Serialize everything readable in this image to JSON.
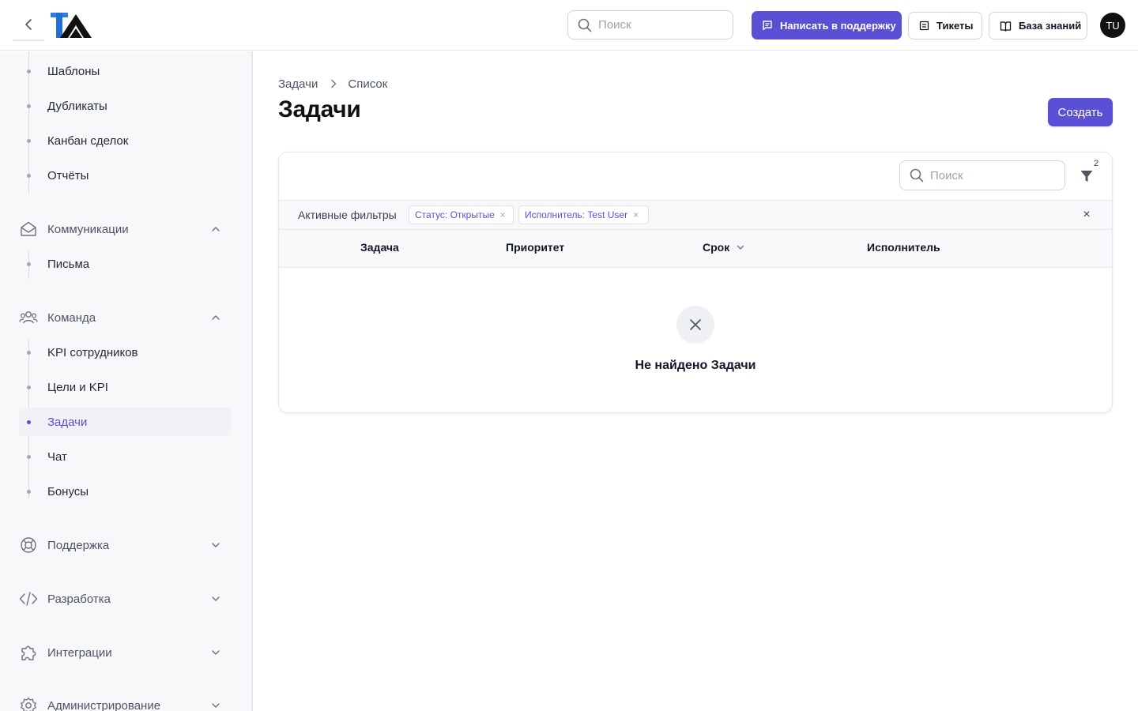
{
  "header": {
    "search_placeholder": "Поиск",
    "support_label": "Написать в поддержку",
    "tickets_label": "Тикеты",
    "kb_label": "База знаний",
    "avatar_initials": "TU"
  },
  "sidebar": {
    "top_items": [
      {
        "label": "Шаблоны"
      },
      {
        "label": "Дубликаты"
      },
      {
        "label": "Канбан сделок"
      },
      {
        "label": "Отчёты"
      }
    ],
    "communications": {
      "label": "Коммуникации",
      "items": [
        {
          "label": "Письма"
        }
      ]
    },
    "team": {
      "label": "Команда",
      "items": [
        {
          "label": "KPI сотрудников"
        },
        {
          "label": "Цели и KPI"
        },
        {
          "label": "Задачи",
          "active": true
        },
        {
          "label": "Чат"
        },
        {
          "label": "Бонусы"
        }
      ]
    },
    "support": {
      "label": "Поддержка"
    },
    "development": {
      "label": "Разработка"
    },
    "integrations": {
      "label": "Интеграции"
    },
    "administration": {
      "label": "Администрирование"
    }
  },
  "main": {
    "breadcrumb": [
      "Задачи",
      "Список"
    ],
    "title": "Задачи",
    "create_label": "Создать",
    "search_placeholder": "Поиск",
    "filter_count": "2",
    "active_filters_label": "Активные фильтры",
    "filters": [
      "Статус: Открытые",
      "Исполнитель: Test User"
    ],
    "filter_remove_glyph": "×",
    "clear_all_glyph": "×",
    "columns": [
      "Задача",
      "Приоритет",
      "Срок",
      "Исполнитель"
    ],
    "empty_text": "Не найдено Задачи"
  },
  "colors": {
    "accent": "#5b4fd6",
    "sidebar_bg": "#f8f8fa",
    "border": "#e5e7eb"
  }
}
